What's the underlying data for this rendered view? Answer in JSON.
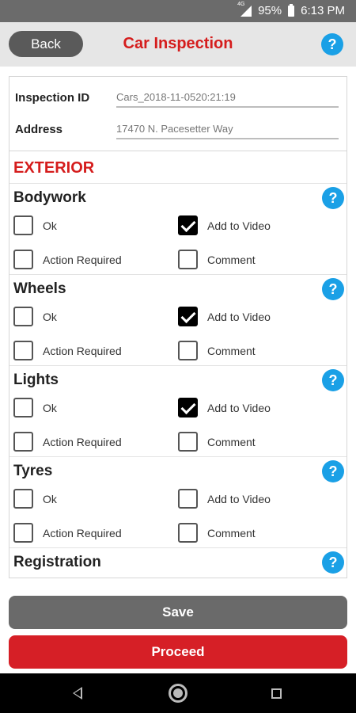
{
  "status_bar": {
    "network": "4G",
    "battery": "95%",
    "time": "6:13 PM"
  },
  "header": {
    "back_label": "Back",
    "title": "Car Inspection",
    "help_label": "?"
  },
  "info": {
    "inspection_id_label": "Inspection ID",
    "inspection_id_value": "Cars_2018-11-0520:21:19",
    "address_label": "Address",
    "address_value": "17470 N. Pacesetter Way"
  },
  "exterior_title": "EXTERIOR",
  "sections": [
    {
      "name": "Bodywork",
      "options": [
        {
          "label": "Ok",
          "checked": false
        },
        {
          "label": "Add to Video",
          "checked": true
        },
        {
          "label": "Action Required",
          "checked": false
        },
        {
          "label": "Comment",
          "checked": false
        }
      ]
    },
    {
      "name": "Wheels",
      "options": [
        {
          "label": "Ok",
          "checked": false
        },
        {
          "label": "Add to Video",
          "checked": true
        },
        {
          "label": "Action Required",
          "checked": false
        },
        {
          "label": "Comment",
          "checked": false
        }
      ]
    },
    {
      "name": "Lights",
      "options": [
        {
          "label": "Ok",
          "checked": false
        },
        {
          "label": "Add to Video",
          "checked": true
        },
        {
          "label": "Action Required",
          "checked": false
        },
        {
          "label": "Comment",
          "checked": false
        }
      ]
    },
    {
      "name": "Tyres",
      "options": [
        {
          "label": "Ok",
          "checked": false
        },
        {
          "label": "Add to Video",
          "checked": false
        },
        {
          "label": "Action Required",
          "checked": false
        },
        {
          "label": "Comment",
          "checked": false
        }
      ]
    },
    {
      "name": "Registration",
      "options": []
    }
  ],
  "buttons": {
    "save_label": "Save",
    "proceed_label": "Proceed"
  },
  "colors": {
    "accent_red": "#d51d1d",
    "help_blue": "#1aa0e6",
    "save_gray": "#6a6a6a",
    "proceed_red": "#d61f26"
  }
}
